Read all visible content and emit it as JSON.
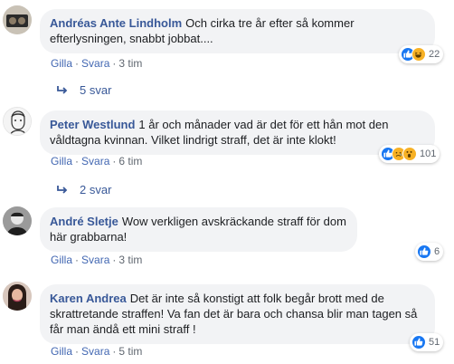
{
  "labels": {
    "like": "Gilla",
    "reply": "Svara",
    "sep": "·"
  },
  "colors": {
    "link": "#385898",
    "action": "#4267b2",
    "bubble": "#f2f3f5"
  },
  "comments": [
    {
      "author": "Andréas Ante Lindholm",
      "text": "Och cirka tre år efter så kommer efterlysningen, snabbt jobbat....",
      "time": "3 tim",
      "reactions": {
        "icons": [
          "like-icon",
          "laugh-icon"
        ],
        "count": "22"
      },
      "replies": "5 svar"
    },
    {
      "author": "Peter Westlund",
      "text": "1 år och månader vad är det för ett hån mot den våldtagna kvinnan. Vilket lindrigt straff, det är inte klokt!",
      "time": "6 tim",
      "reactions": {
        "icons": [
          "like-icon",
          "sad-icon",
          "wow-icon"
        ],
        "count": "101"
      },
      "replies": "2 svar"
    },
    {
      "author": "André Sletje",
      "text": "Wow verkligen avskräckande straff för dom här grabbarna!",
      "time": "3 tim",
      "reactions": {
        "icons": [
          "like-icon"
        ],
        "count": "6"
      }
    },
    {
      "author": "Karen Andrea",
      "text": "Det är inte så konstigt att folk begår brott med de skrattretande straffen! Va fan det är bara och chansa blir man tagen så får man ändå ett mini straff !",
      "time": "5 tim",
      "reactions": {
        "icons": [
          "like-icon"
        ],
        "count": "51"
      }
    }
  ]
}
